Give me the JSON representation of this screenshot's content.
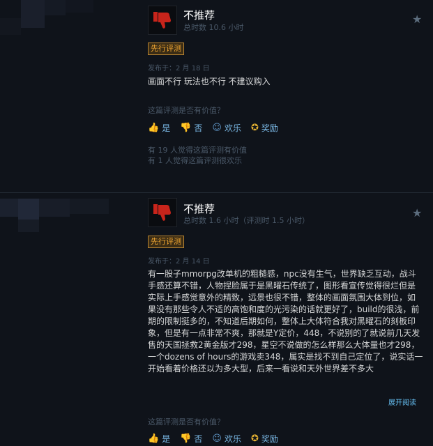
{
  "reviews": [
    {
      "verdict": "不推荐",
      "hours": "总时数 10.6 小时",
      "badge": "先行评测",
      "posted": "发布于：2 月 18 日",
      "body": "画面不行 玩法也不行 不建议购入",
      "question": "这篇评测是否有价值？",
      "votes": {
        "yes": "是",
        "no": "否",
        "funny": "欢乐",
        "award": "奖励"
      },
      "helpful_line1": "有 19 人觉得这篇评测有价值",
      "helpful_line2": "有 1 人觉得这篇评测很欢乐"
    },
    {
      "verdict": "不推荐",
      "hours": "总时数 1.6 小时（评测时 1.5 小时）",
      "badge": "先行评测",
      "posted": "发布于：2 月 14 日",
      "body": "有一股子mmorpg改单机的粗糙感，npc没有生气，世界缺乏互动，战斗手感还算不错，人物捏脸属于是黑曜石传统了，图形看宣传觉得很烂但是实际上手感觉意外的精致，远景也很不错，整体的画面氛围大体到位，如果没有那些令人不适的高饱和度的光污染的话就更好了，build的很浅，前期的限制挺多的，不知道后期如何，整体上大体符合我对黑曜石的刻板印象，但是有一点非常不爽，那就是Y定价，448，不说别的了就说前几天发售的天国拯救2黄金版才298，星空不说做的怎么样那么大体量也才298，一个dozens of hours的游戏卖348，属实是找不到自己定位了，说实话一开始看着价格还以为多大型，后来一看说和天外世界差不多大",
      "expand": "展开阅读",
      "question": "这篇评测是否有价值？",
      "votes": {
        "yes": "是",
        "no": "否",
        "funny": "欢乐",
        "award": "奖励"
      }
    }
  ],
  "colors": {
    "background": "#0f131a",
    "thumb_down_red": "#c8241b",
    "badge_orange": "#f3a832",
    "link_blue": "#66c0f4"
  }
}
